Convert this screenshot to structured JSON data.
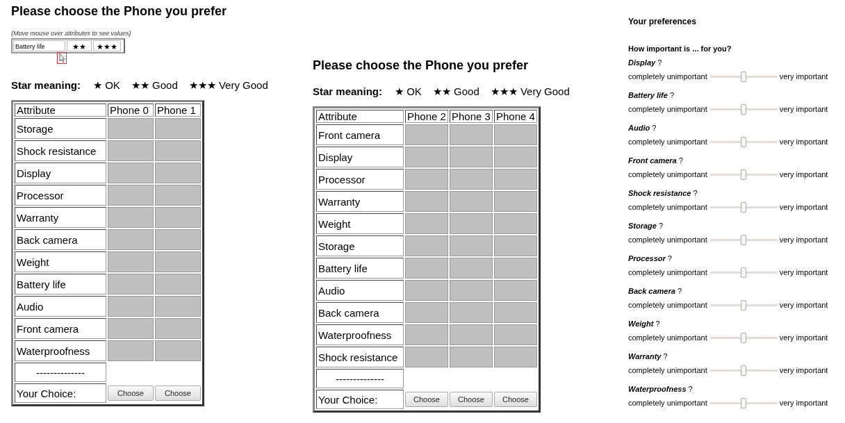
{
  "choice_panels": [
    {
      "title": "Please choose the Phone you prefer",
      "hint": "(Move mouse over attributes to see values)",
      "hover_preview": {
        "attribute": "Battery life",
        "values": [
          "★★",
          "★★★"
        ]
      },
      "star_meaning": {
        "label": "Star meaning:",
        "items": [
          "★ OK",
          "★★ Good",
          "★★★ Very Good"
        ]
      },
      "table": {
        "columns": [
          "Attribute",
          "Phone 0",
          "Phone 1"
        ],
        "rows": [
          "Storage",
          "Shock resistance",
          "Display",
          "Processor",
          "Warranty",
          "Back camera",
          "Weight",
          "Battery life",
          "Audio",
          "Front camera",
          "Waterproofness"
        ],
        "separator": "--------------",
        "choice_label": "Your Choice:",
        "buttons": [
          "Choose",
          "Choose"
        ]
      }
    },
    {
      "title": "Please choose the Phone you prefer",
      "star_meaning": {
        "label": "Star meaning:",
        "items": [
          "★ OK",
          "★★ Good",
          "★★★ Very Good"
        ]
      },
      "table": {
        "columns": [
          "Attribute",
          "Phone 2",
          "Phone 3",
          "Phone 4"
        ],
        "rows": [
          "Front camera",
          "Display",
          "Processor",
          "Warranty",
          "Weight",
          "Storage",
          "Battery life",
          "Audio",
          "Back camera",
          "Waterproofness",
          "Shock resistance"
        ],
        "separator": "--------------",
        "choice_label": "Your Choice:",
        "buttons": [
          "Choose",
          "Choose",
          "Choose"
        ]
      }
    }
  ],
  "preferences": {
    "title": "Your preferences",
    "question": "How important is ... for you?",
    "items": [
      {
        "attribute": "Display",
        "mark": "?",
        "min_label": "completely unimportant",
        "max_label": "very important",
        "level": 0.5
      },
      {
        "attribute": "Battery life",
        "mark": "?",
        "min_label": "completely unimportant",
        "max_label": "very important",
        "level": 0.5
      },
      {
        "attribute": "Audio",
        "mark": "?",
        "min_label": "completely unimportant",
        "max_label": "very important",
        "level": 0.5
      },
      {
        "attribute": "Front camera",
        "mark": "?",
        "min_label": "completely unimportant",
        "max_label": "very important",
        "level": 0.5
      },
      {
        "attribute": "Shock resistance",
        "mark": "?",
        "min_label": "completely unimportant",
        "max_label": "very important",
        "level": 0.5
      },
      {
        "attribute": "Storage",
        "mark": "?",
        "min_label": "completely unimportant",
        "max_label": "very important",
        "level": 0.5
      },
      {
        "attribute": "Processor",
        "mark": "?",
        "min_label": "completely unimportant",
        "max_label": "very important",
        "level": 0.5
      },
      {
        "attribute": "Back camera",
        "mark": "?",
        "min_label": "completely unimportant",
        "max_label": "very important",
        "level": 0.5
      },
      {
        "attribute": "Weight",
        "mark": "?",
        "min_label": "completely unimportant",
        "max_label": "very important",
        "level": 0.5
      },
      {
        "attribute": "Warranty",
        "mark": "?",
        "min_label": "completely unimportant",
        "max_label": "very important",
        "level": 0.5
      },
      {
        "attribute": "Waterproofness",
        "mark": "?",
        "min_label": "completely unimportant",
        "max_label": "very important",
        "level": 0.5
      }
    ]
  }
}
